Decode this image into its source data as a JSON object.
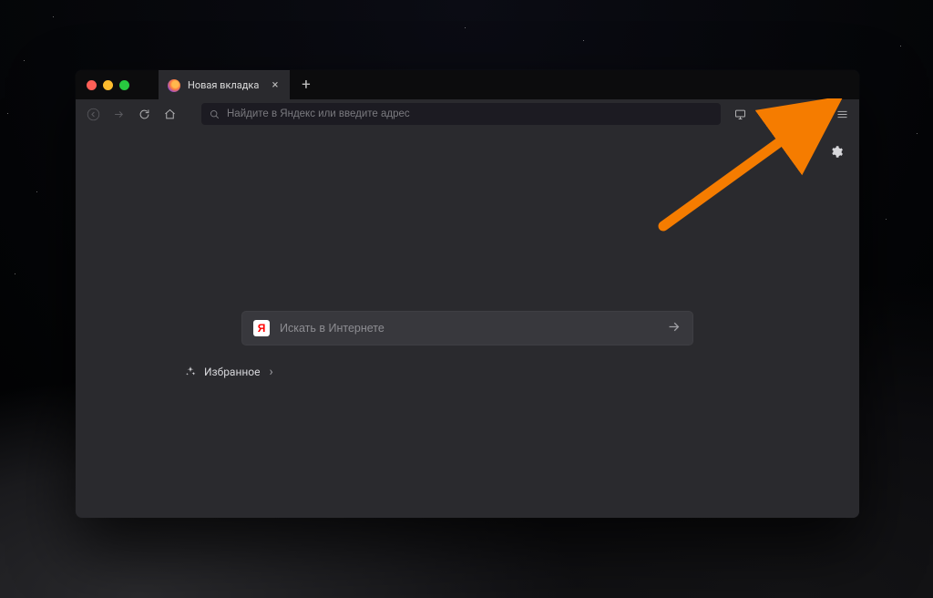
{
  "tabbar": {
    "tab_title": "Новая вкладка",
    "close_glyph": "×",
    "plus_glyph": "+"
  },
  "navbar": {
    "url_placeholder": "Найдите в Яндекс или введите адрес"
  },
  "home": {
    "search_placeholder": "Искать в Интернете",
    "yandex_logo_letter": "Я",
    "favorites_label": "Избранное",
    "favorites_chevron": "›"
  },
  "colors": {
    "arrow": "#f57c00",
    "window_bg": "#1c1b22",
    "chrome_bg": "#2a2a2e"
  }
}
